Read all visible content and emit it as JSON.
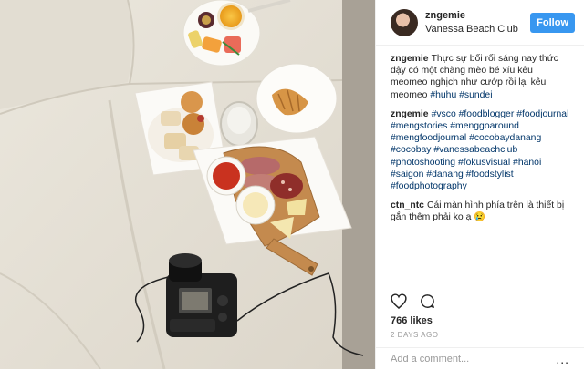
{
  "post": {
    "username": "zngemie",
    "location": "Vanessa Beach Club",
    "follow_label": "Follow"
  },
  "comments": [
    {
      "user": "zngemie",
      "parts": [
        {
          "t": "Thực sự bối rối sáng nay thức dậy có một chàng mèo bé xíu kêu meomeo nghịch như cướp rồi lại kêu meomeo ",
          "tag": false
        },
        {
          "t": "#huhu",
          "tag": true
        },
        {
          "t": " ",
          "tag": false
        },
        {
          "t": "#sundei",
          "tag": true
        }
      ]
    },
    {
      "user": "zngemie",
      "parts": [
        {
          "t": "#vsco",
          "tag": true
        },
        {
          "t": " ",
          "tag": false
        },
        {
          "t": "#foodblogger",
          "tag": true
        },
        {
          "t": " ",
          "tag": false
        },
        {
          "t": "#foodjournal",
          "tag": true
        },
        {
          "t": " ",
          "tag": false
        },
        {
          "t": "#mengstories",
          "tag": true
        },
        {
          "t": " ",
          "tag": false
        },
        {
          "t": "#menggoaround",
          "tag": true
        },
        {
          "t": " ",
          "tag": false
        },
        {
          "t": "#mengfoodjournal",
          "tag": true
        },
        {
          "t": " ",
          "tag": false
        },
        {
          "t": "#cocobaydanang",
          "tag": true
        },
        {
          "t": " ",
          "tag": false
        },
        {
          "t": "#cocobay",
          "tag": true
        },
        {
          "t": " ",
          "tag": false
        },
        {
          "t": "#vanessabeachclub",
          "tag": true
        },
        {
          "t": " ",
          "tag": false
        },
        {
          "t": "#photoshooting",
          "tag": true
        },
        {
          "t": " ",
          "tag": false
        },
        {
          "t": "#fokusvisual",
          "tag": true
        },
        {
          "t": " ",
          "tag": false
        },
        {
          "t": "#hanoi",
          "tag": true
        },
        {
          "t": " ",
          "tag": false
        },
        {
          "t": "#saigon",
          "tag": true
        },
        {
          "t": " ",
          "tag": false
        },
        {
          "t": "#danang",
          "tag": true
        },
        {
          "t": " ",
          "tag": false
        },
        {
          "t": "#foodstylist",
          "tag": true
        },
        {
          "t": " ",
          "tag": false
        },
        {
          "t": "#foodphotography",
          "tag": true
        }
      ]
    },
    {
      "user": "ctn_ntc",
      "parts": [
        {
          "t": "Cái màn hình phía trên là thiết bị gắn thêm phải ko ạ ",
          "tag": false
        },
        {
          "t": "😢",
          "tag": false
        }
      ]
    }
  ],
  "stats": {
    "likes": "766 likes",
    "time": "2 DAYS AGO"
  },
  "add_comment": {
    "placeholder": "Add a comment...",
    "more": "..."
  },
  "icons": {
    "heart": "heart-icon",
    "comment": "comment-bubble-icon",
    "more": "more-options-icon"
  },
  "colors": {
    "follow_button": "#3897f0",
    "hashtag": "#003569",
    "muted": "#999999"
  }
}
